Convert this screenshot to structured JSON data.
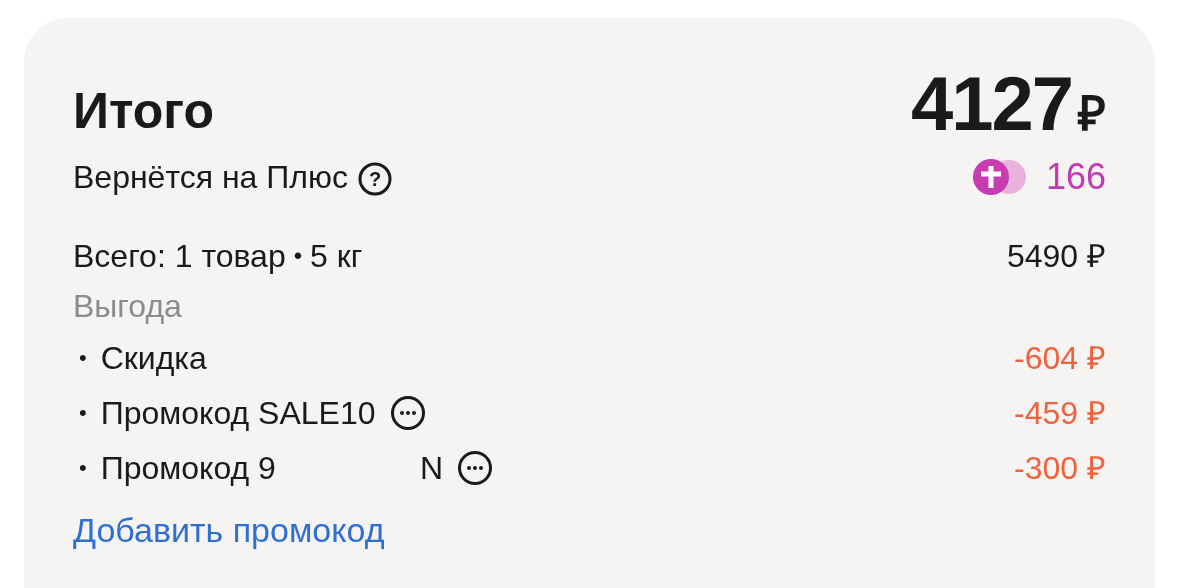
{
  "summary": {
    "title": "Итого",
    "total": "4127",
    "currency": "₽"
  },
  "cashback": {
    "label": "Вернётся на Плюс",
    "help_glyph": "?",
    "amount": "166"
  },
  "items_total": {
    "label": "Всего: 1 товар",
    "separator": "•",
    "weight": "5 кг",
    "amount": "5490 ₽"
  },
  "benefit_heading": "Выгода",
  "discounts": [
    {
      "bullet": "•",
      "label": "Скидка",
      "has_menu": false,
      "amount": "-604 ₽"
    },
    {
      "bullet": "•",
      "label": "Промокод SALE10",
      "has_menu": true,
      "amount": "-459 ₽"
    },
    {
      "bullet": "•",
      "label": "Промокод 9",
      "label_end": "N",
      "has_menu": true,
      "amount": "-300 ₽"
    }
  ],
  "add_promo_link": "Добавить промокод"
}
